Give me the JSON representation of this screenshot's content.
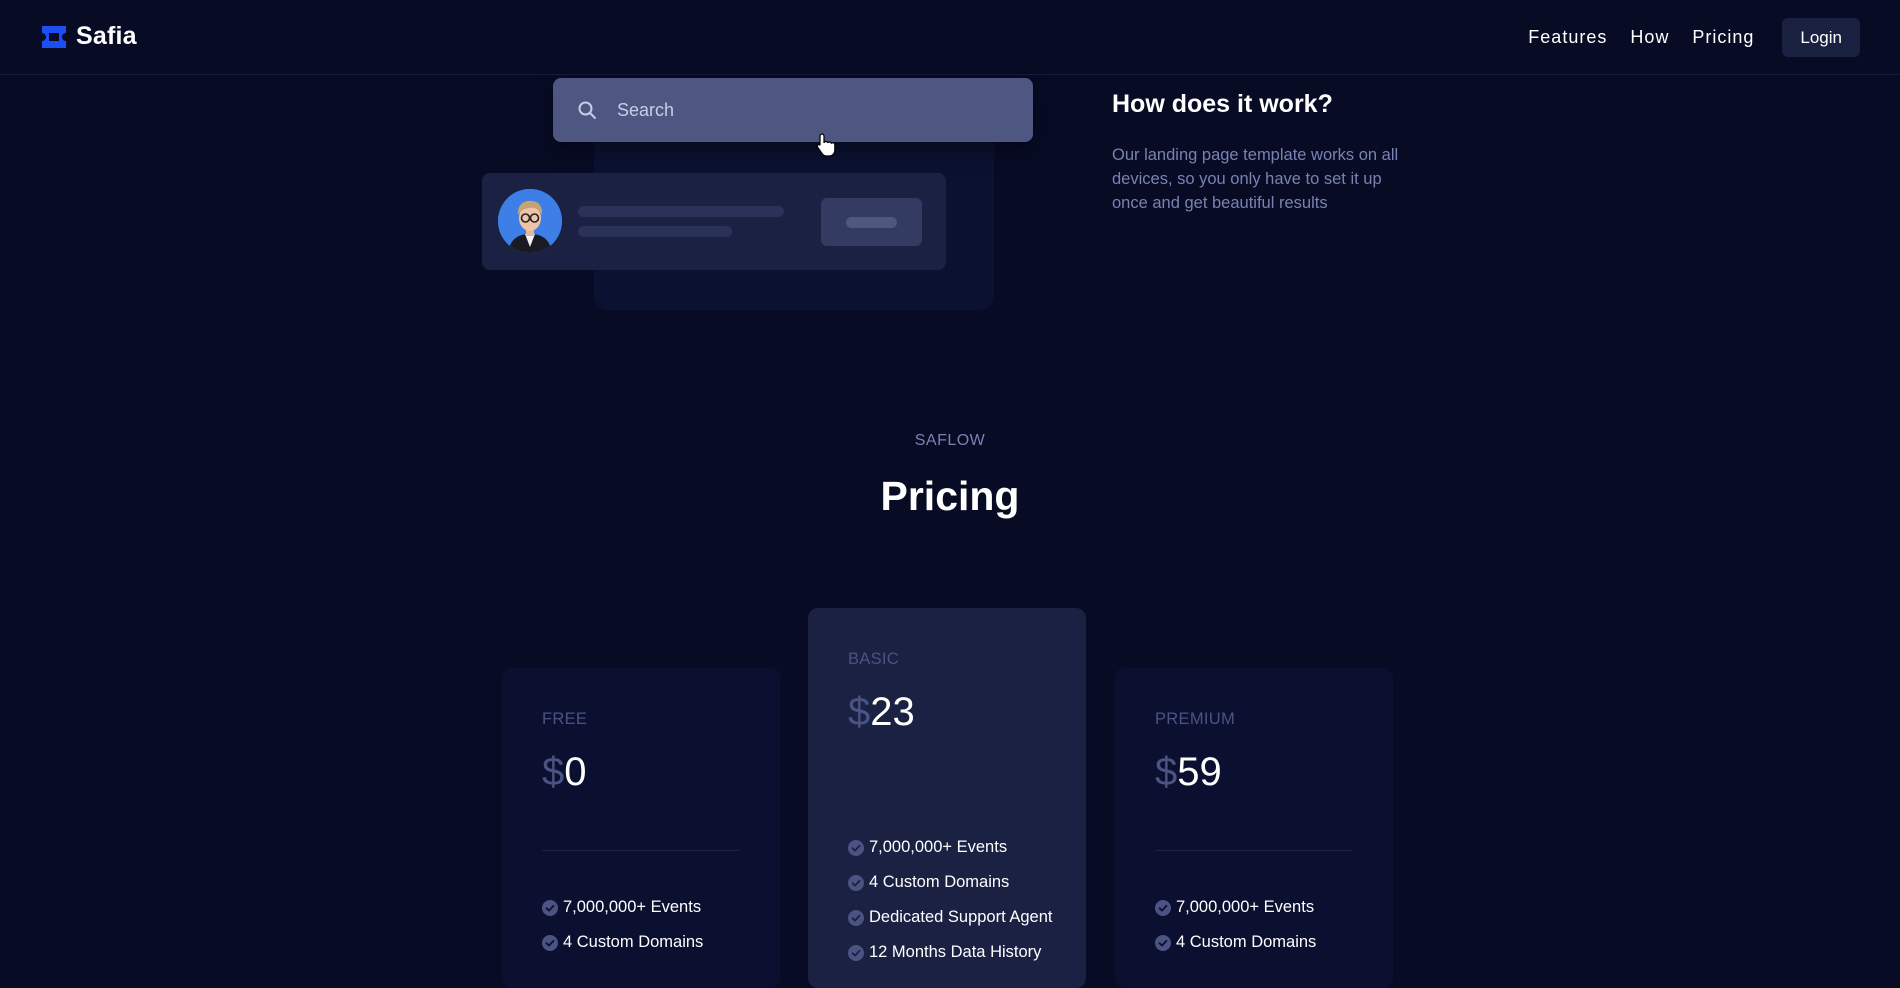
{
  "header": {
    "brand_name": "Safia",
    "nav": [
      "Features",
      "How",
      "Pricing"
    ],
    "login_label": "Login"
  },
  "mockup": {
    "search_placeholder": "Search"
  },
  "how": {
    "title": "How does it work?",
    "description": "Our landing page template works on all devices, so you only have to set it up once and get beautiful results"
  },
  "pricing": {
    "kicker": "SAFLOW",
    "title": "Pricing",
    "plans": [
      {
        "name": "FREE",
        "currency": "$",
        "amount": "0",
        "features": [
          "7,000,000+ Events",
          "4 Custom Domains"
        ]
      },
      {
        "name": "BASIC",
        "currency": "$",
        "amount": "23",
        "features": [
          "7,000,000+ Events",
          "4 Custom Domains",
          "Dedicated Support Agent",
          "12 Months Data History"
        ]
      },
      {
        "name": "PREMIUM",
        "currency": "$",
        "amount": "59",
        "features": [
          "7,000,000+ Events",
          "4 Custom Domains"
        ]
      }
    ]
  },
  "colors": {
    "background": "#070b24",
    "brand_blue": "#1d4ef5",
    "card": "#1a2143",
    "muted_text": "#7983b3"
  },
  "icons": [
    "logo-icon",
    "search-icon",
    "cursor-icon",
    "check-icon"
  ]
}
